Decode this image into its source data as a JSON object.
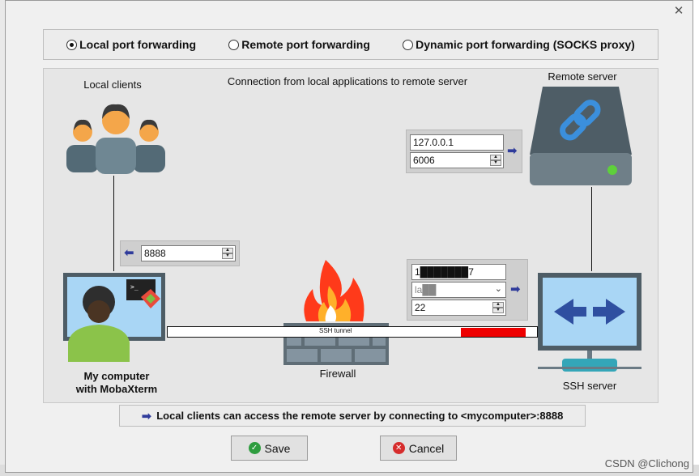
{
  "dialog": {
    "close_icon": "close-icon"
  },
  "radio": {
    "options": [
      {
        "label": "Local port forwarding",
        "checked": true
      },
      {
        "label": "Remote port forwarding",
        "checked": false
      },
      {
        "label": "Dynamic port forwarding (SOCKS proxy)",
        "checked": false
      }
    ]
  },
  "diagram": {
    "local_clients_label": "Local clients",
    "connection_title": "Connection from local applications to remote server",
    "remote_server_label": "Remote server",
    "my_computer_label_line1": "My computer",
    "my_computer_label_line2": "with MobaXterm",
    "firewall_label": "Firewall",
    "ssh_server_label": "SSH server",
    "ssh_tunnel_label": "SSH tunnel",
    "fields": {
      "remote_host": "127.0.0.1",
      "remote_port": "6006",
      "local_port": "8888",
      "ssh_server_host": "1███████7",
      "ssh_user": "la██",
      "ssh_port": "22"
    }
  },
  "info_text": "Local clients can access the remote server by connecting to <mycomputer>:8888",
  "buttons": {
    "save": "Save",
    "cancel": "Cancel"
  },
  "watermark": "CSDN @Clichong",
  "colors": {
    "tunnel_red": "#ee0000",
    "arrow_blue": "#2f3b9b",
    "save_green": "#2e9d3f",
    "cancel_red": "#d62c2c"
  }
}
